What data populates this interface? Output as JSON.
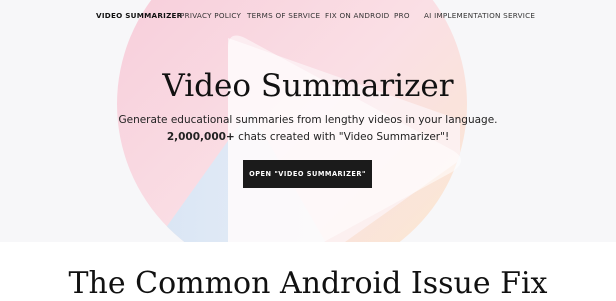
{
  "nav": {
    "items": [
      {
        "label": "VIDEO SUMMARIZER"
      },
      {
        "label": "PRIVACY POLICY"
      },
      {
        "label": "TERMS OF SERVICE"
      },
      {
        "label": "FIX ON ANDROID"
      },
      {
        "label": "PRO"
      },
      {
        "label": "AI IMPLEMENTATION SERVICE"
      }
    ]
  },
  "hero": {
    "title": "Video Summarizer",
    "subtitle": "Generate educational summaries from lengthy videos in your language.",
    "count_bold": "2,000,000+",
    "count_rest": " chats created with \"Video Summarizer\"!",
    "cta_label": "OPEN \"VIDEO SUMMARIZER\""
  },
  "section": {
    "heading": "The Common Android Issue Fix"
  },
  "colors": {
    "hero_bg": "#f7f7f9",
    "cta_bg": "#1b1b1b",
    "circle_pink": "#f8d3df",
    "circle_orange": "#fbe6d2",
    "circle_blue": "#d8e8f6",
    "play_shape": "#ffffff"
  },
  "icons": {
    "background": "play-logo-icon"
  }
}
